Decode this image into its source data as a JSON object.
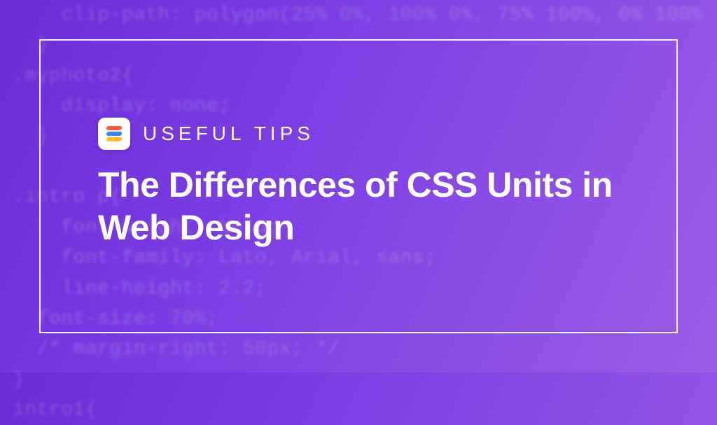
{
  "eyebrow": "USEFUL TIPS",
  "title": "The Differences of CSS Units in Web Design",
  "logo_name": "stackable-logo",
  "bg_code": "    clip-path: polygon(25% 0%, 100% 0%, 75% 100%, 0% 100%\n  }\n.myphoto2{\n    display: none;\n  }\n\n.intro p{\n    font-weight: bold;\n    font-family: Lato, Arial, sans;\n    line-height: 2.2;\n  font-size: 70%;\n  /* margin-right: 50px; */\n}\nintro1{"
}
